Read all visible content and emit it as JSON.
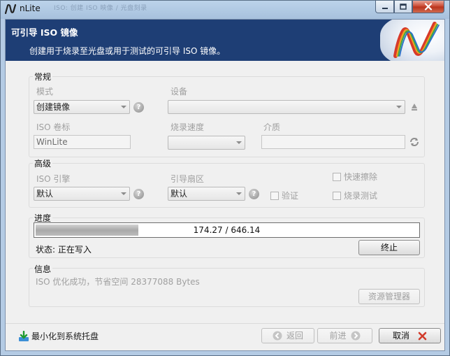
{
  "window": {
    "title": "nLite",
    "ghost_title": "ISO: 创建 ISO 映像 / 光盘刻录",
    "colors": {
      "banner": "#1e3e75",
      "progress_fill": "#b6b6b6"
    }
  },
  "banner": {
    "heading": "可引导 ISO 镜像",
    "subtitle": "创建用于烧录至光盘或用于测试的可引导 ISO 镜像。",
    "logo_icon": "nlite-logo-icon"
  },
  "general": {
    "label": "常规",
    "mode_label": "模式",
    "mode_value": "创建镜像",
    "device_label": "设备",
    "device_value": "",
    "iso_label_label": "ISO 卷标",
    "iso_label_value": "WinLite",
    "speed_label": "烧录速度",
    "speed_value": "",
    "media_label": "介质",
    "media_value": ""
  },
  "advanced": {
    "label": "高级",
    "engine_label": "ISO 引擎",
    "engine_value": "默认",
    "boot_label": "引导扇区",
    "boot_value": "默认",
    "verify_label": "验证",
    "quick_erase_label": "快速擦除",
    "burn_test_label": "烧录测试"
  },
  "progress": {
    "label": "进度",
    "text": "174.27 / 646.14",
    "fraction": 0.27,
    "status_label": "状态: 正在写入",
    "stop_button": "终止"
  },
  "info": {
    "label": "信息",
    "message": "ISO 优化成功，节省空间 28377088 Bytes",
    "explorer_button": "资源管理器"
  },
  "footer": {
    "minimize_tray": "最小化到系统托盘",
    "back_button": "返回",
    "next_button": "前进",
    "cancel_button": "取消"
  }
}
